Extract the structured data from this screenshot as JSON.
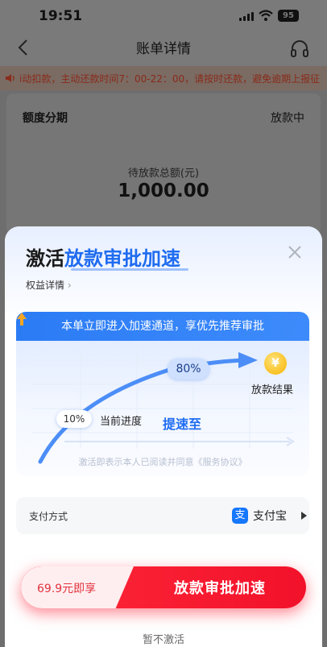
{
  "status_bar": {
    "time": "19:51",
    "battery": "95"
  },
  "header": {
    "title": "账单详情"
  },
  "notice": {
    "text": "i动扣款，主动还款时间7：00-22：00，请按时还款，避免逾期上报征"
  },
  "bill": {
    "type": "额度分期",
    "status": "放款中",
    "amount_label": "待放款总额(元)",
    "amount": "1,000.00"
  },
  "sheet": {
    "title_prefix": "激活",
    "title_highlight": "放款审批加速",
    "rights_link": "权益详情",
    "banner": "本单立即进入加速通道，享优先推荐审批",
    "progress": {
      "current_percent": "10%",
      "current_label": "当前进度",
      "target_percent": "80%",
      "speedup_label": "提速至",
      "result_label": "放款结果",
      "result_icon": "¥"
    },
    "agreement": "激活即表示本人已阅读并同意《服务协议》",
    "payment": {
      "label": "支付方式",
      "icon": "支",
      "method": "支付宝"
    },
    "cta": {
      "price": "69.9元即享",
      "label": "放款审批加速"
    },
    "skip": "暂不激活"
  }
}
